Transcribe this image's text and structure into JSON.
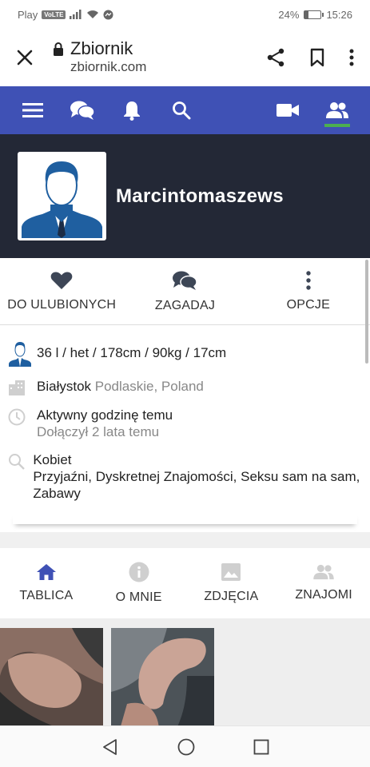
{
  "status_bar": {
    "carrier": "Play",
    "volte": "VoLTE",
    "battery_text": "24%",
    "battery_level": 0.24,
    "time": "15:26"
  },
  "browser": {
    "title": "Zbiornik",
    "url": "zbiornik.com"
  },
  "nav": {
    "icons": [
      "menu-icon",
      "chat-icon",
      "bell-icon",
      "search-icon",
      "video-camera-icon",
      "friends-icon"
    ],
    "accent": "#3f51b5",
    "active_indicator": "#4caf50"
  },
  "profile": {
    "username": "Marcintomaszews"
  },
  "actions": [
    {
      "label": "DO ULUBIONYCH",
      "icon": "heart-icon"
    },
    {
      "label": "ZAGADAJ",
      "icon": "chat-icon"
    },
    {
      "label": "OPCJE",
      "icon": "more-vertical-icon"
    }
  ],
  "info": {
    "stats": "36 l / het / 178cm / 90kg / 17cm",
    "city": "Białystok",
    "region": "Podlaskie, Poland",
    "activity": "Aktywny godzinę temu",
    "joined": "Dołączył 2 lata temu",
    "looking_for": "Kobiet",
    "interests": "Przyjaźni, Dyskretnej Znajomości, Seksu sam na sam, Zabawy"
  },
  "tabs": [
    {
      "label": "TABLICA",
      "icon": "home-icon",
      "active": true
    },
    {
      "label": "O MNIE",
      "icon": "info-icon",
      "active": false
    },
    {
      "label": "ZDJĘCIA",
      "icon": "image-icon",
      "active": false
    },
    {
      "label": "ZNAJOMI",
      "icon": "friends-icon",
      "active": false
    }
  ]
}
